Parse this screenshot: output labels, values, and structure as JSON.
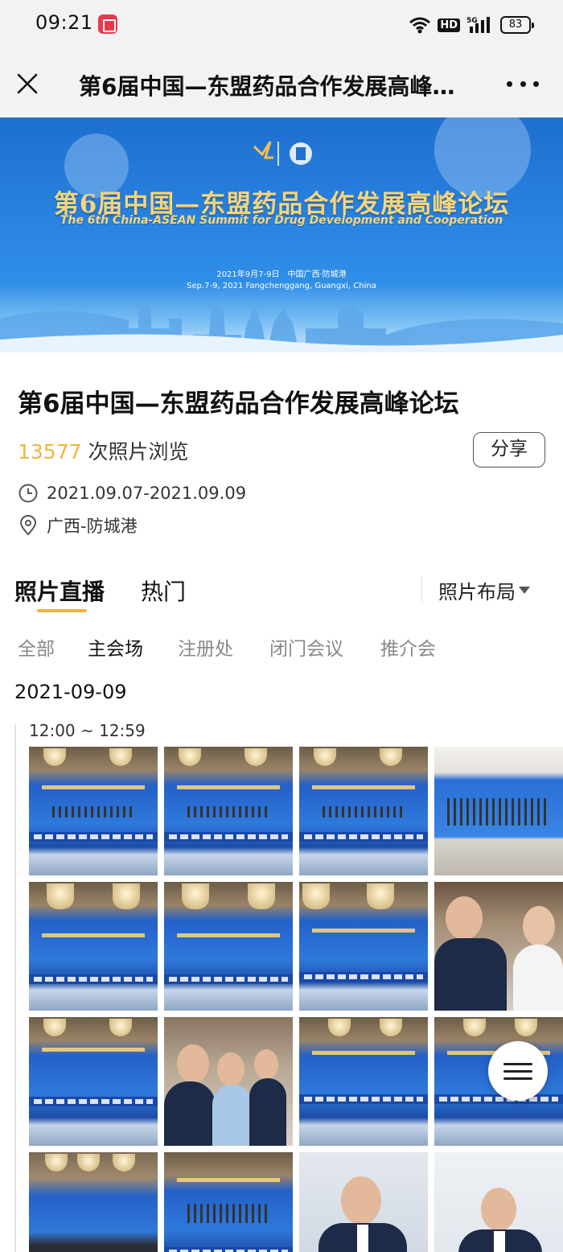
{
  "status_bar": {
    "time": "09:21",
    "network_badge": "HD",
    "network_type": "5G",
    "battery": "83"
  },
  "nav": {
    "title": "第6届中国—东盟药品合作发展高峰论坛"
  },
  "banner": {
    "title_cn": "第6届中国—东盟药品合作发展高峰论坛",
    "title_en": "The 6th China-ASEAN Summit for Drug Development and Cooperation",
    "date_cn": "2021年9月7-9日　中国广西·防城港",
    "date_en": "Sep.7-9, 2021 Fangchenggang, Guangxi, China"
  },
  "event": {
    "title": "第6届中国—东盟药品合作发展高峰论坛",
    "views_count": "13577",
    "views_label": "次照片浏览",
    "share_label": "分享",
    "date_range": "2021.09.07-2021.09.09",
    "location": "广西-防城港"
  },
  "tabs": {
    "live": "照片直播",
    "hot": "热门",
    "layout": "照片布局"
  },
  "sub_tabs": [
    "全部",
    "主会场",
    "注册处",
    "闭门会议",
    "推介会"
  ],
  "active_sub_tab": "主会场",
  "timeline": {
    "date": "2021-09-09",
    "time_range": "12:00 ~ 12:59"
  },
  "colors": {
    "accent": "#f0b53b",
    "banner_blue": "#2a83e0",
    "title_gold": "#f6d57a"
  }
}
